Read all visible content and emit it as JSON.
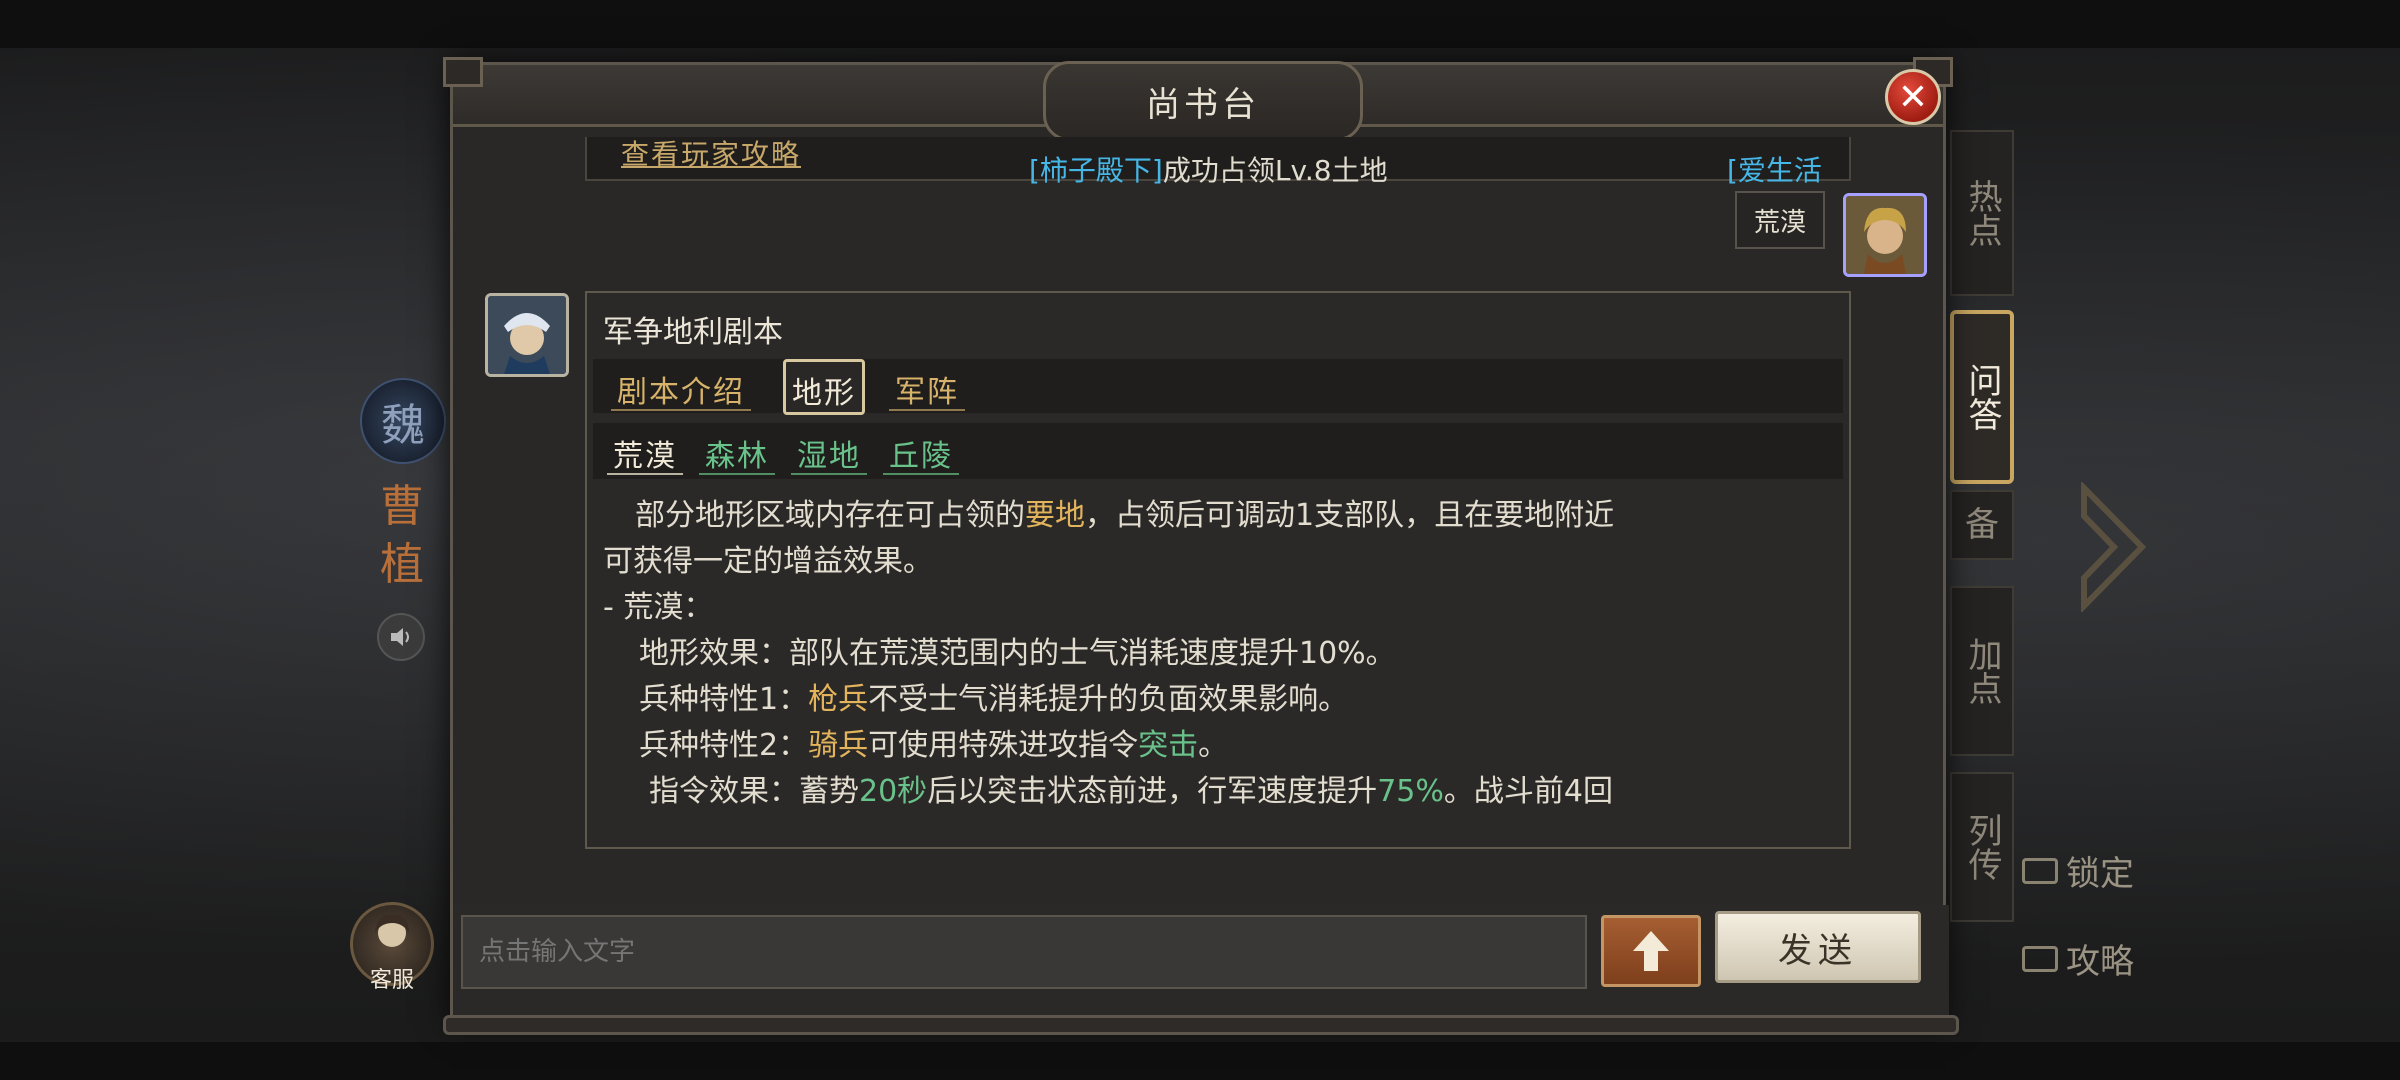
{
  "modal": {
    "title": "尚书台"
  },
  "broadcast": {
    "link_text": "查看玩家攻略",
    "player_name": "[柿子殿下]",
    "message": "成功占领Lv.8土地",
    "player_name_2": "[爱生活"
  },
  "user_message": {
    "text": "荒漠"
  },
  "response": {
    "title": "军争地利剧本",
    "category_tabs": [
      {
        "label": "剧本介绍"
      },
      {
        "label": "地形"
      },
      {
        "label": "军阵"
      }
    ],
    "terrain_tabs": [
      {
        "label": "荒漠"
      },
      {
        "label": "森林"
      },
      {
        "label": "湿地"
      },
      {
        "label": "丘陵"
      }
    ],
    "body": {
      "l1_a": "部分地形区域内存在可占领的",
      "l1_b": "要地",
      "l1_c": "，占领后可调动1支部队，且在要地附近",
      "l2": "可获得一定的增益效果。",
      "l3": "- 荒漠：",
      "l4": "地形效果：部队在荒漠范围内的士气消耗速度提升10%。",
      "l5_a": "兵种特性1：",
      "l5_b": "枪兵",
      "l5_c": "不受士气消耗提升的负面效果影响。",
      "l6_a": "兵种特性2：",
      "l6_b": "骑兵",
      "l6_c": "可使用特殊进攻指令",
      "l6_d": "突击",
      "l6_e": "。",
      "l7_a": "指令效果：蓄势",
      "l7_b": "20秒",
      "l7_c": "后以突击状态前进，行军速度提升",
      "l7_d": "75%",
      "l7_e": "。战斗前4回"
    }
  },
  "input": {
    "placeholder": "点击输入文字",
    "send_label": "发送"
  },
  "customer_service": {
    "label": "客服"
  },
  "side_tabs": [
    {
      "label": "热点"
    },
    {
      "label": "问答"
    },
    {
      "label": "备"
    },
    {
      "label": "加点"
    },
    {
      "label": "列传"
    }
  ],
  "background": {
    "faction": "魏",
    "hero_name": "曹植",
    "lock_label": "锁定",
    "guide_label": "攻略"
  },
  "colors": {
    "gold": "#d7b26a",
    "green": "#6ac28b",
    "blue_name": "#45b6e6",
    "close_red": "#c0271a"
  }
}
